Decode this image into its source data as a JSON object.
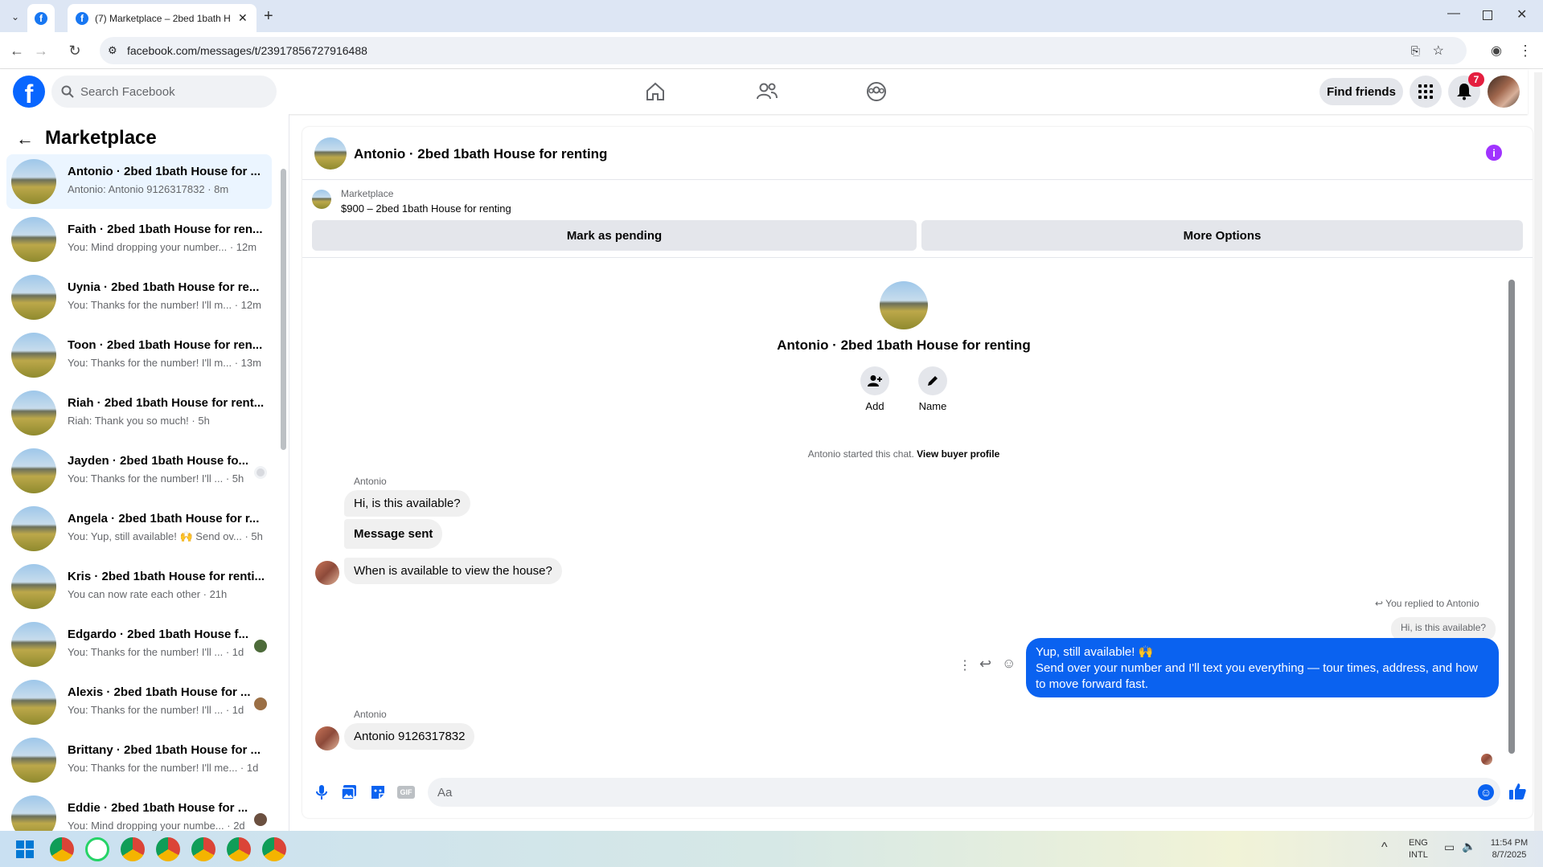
{
  "browser": {
    "tab_title": "(7) Marketplace – 2bed 1bath H",
    "url": "facebook.com/messages/t/23917856727916488"
  },
  "fb": {
    "search_placeholder": "Search Facebook",
    "find_friends": "Find friends",
    "notif_count": "7"
  },
  "sidebar": {
    "title": "Marketplace",
    "conversations": [
      {
        "title": "Antonio · 2bed 1bath House for ...",
        "snippet": "Antonio: Antonio 9126317832 · 8m"
      },
      {
        "title": "Faith · 2bed 1bath House for ren...",
        "snippet": "You: Mind dropping your number... · 12m"
      },
      {
        "title": "Uynia · 2bed 1bath House for re...",
        "snippet": "You: Thanks for the number! I'll m... · 12m"
      },
      {
        "title": "Toon · 2bed 1bath House for ren...",
        "snippet": "You: Thanks for the number! I'll m... · 13m"
      },
      {
        "title": "Riah · 2bed 1bath House for rent...",
        "snippet": "Riah: Thank you so much! · 5h"
      },
      {
        "title": "Jayden · 2bed 1bath House fo...",
        "snippet": "You: Thanks for the number! I'll ... · 5h"
      },
      {
        "title": "Angela · 2bed 1bath House for r...",
        "snippet": "You: Yup, still available! 🙌 Send ov... · 5h"
      },
      {
        "title": "Kris · 2bed 1bath House for renti...",
        "snippet": "You can now rate each other · 21h"
      },
      {
        "title": "Edgardo · 2bed 1bath House f...",
        "snippet": "You: Thanks for the number! I'll ... · 1d"
      },
      {
        "title": "Alexis · 2bed 1bath House for ...",
        "snippet": "You: Thanks for the number! I'll ... · 1d"
      },
      {
        "title": "Brittany · 2bed 1bath House for ...",
        "snippet": "You: Thanks for the number! I'll me... · 1d"
      },
      {
        "title": "Eddie · 2bed 1bath House for ...",
        "snippet": "You: Mind dropping your numbe... · 2d"
      }
    ]
  },
  "chat": {
    "header_title": "Antonio · 2bed 1bath House for renting",
    "listing_label": "Marketplace",
    "listing_price_title": "$900 – 2bed 1bath House for renting",
    "mark_pending": "Mark as pending",
    "more_options": "More Options",
    "center_title": "Antonio · 2bed 1bath House for renting",
    "add_label": "Add",
    "name_label": "Name",
    "started_text": "Antonio started this chat.",
    "view_profile": "View buyer profile",
    "sender_name_1": "Antonio",
    "msg1": "Hi, is this available?",
    "msg2": "Message sent",
    "msg3": "When is available to view the house?",
    "replied_to": "You replied to Antonio",
    "replied_quote": "Hi, is this available?",
    "my_msg_line1": "Yup, still available! 🙌",
    "my_msg_line2": "Send over your number and I'll text you everything — tour times, address, and how",
    "my_msg_line3": "to move forward fast.",
    "sender_name_2": "Antonio",
    "msg4": "Antonio 9126317832",
    "composer_placeholder": "Aa"
  },
  "taskbar": {
    "lang1": "ENG",
    "lang2": "INTL",
    "time": "11:54 PM",
    "date": "8/7/2025"
  },
  "colors": {
    "brand_blue": "#0866ff",
    "messenger_blue": "#0a62f0",
    "badge_red": "#e41e3f",
    "info_purple": "#a033ff"
  }
}
